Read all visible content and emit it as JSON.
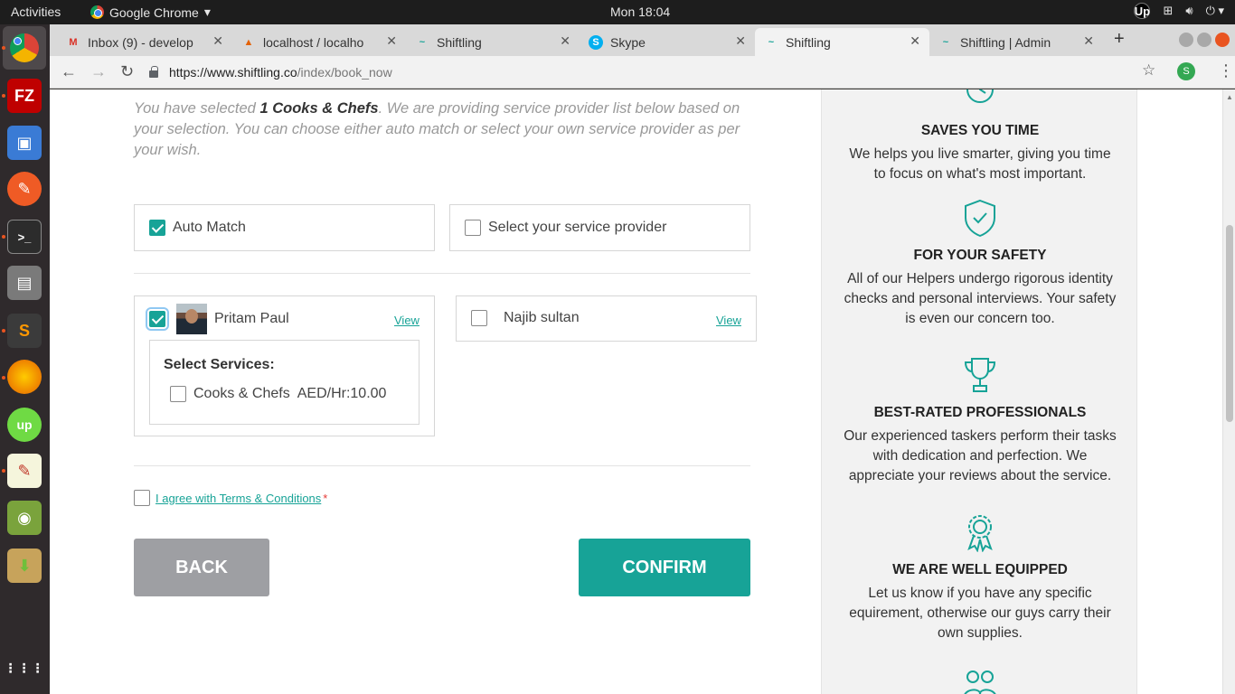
{
  "desktop": {
    "activities": "Activities",
    "app_name": "Google Chrome",
    "clock": "Mon 18:04",
    "tray_badge": "Up"
  },
  "dock": {
    "items": [
      {
        "name": "chrome",
        "color": "#4285f4"
      },
      {
        "name": "filezilla",
        "label": "FZ",
        "color": "#bf0000"
      },
      {
        "name": "image-viewer",
        "color": "#3a7bd5"
      },
      {
        "name": "postman",
        "color": "#ef5b25"
      },
      {
        "name": "terminal",
        "label": ">_",
        "color": "#2c2c2c"
      },
      {
        "name": "files",
        "color": "#7a7a7a"
      },
      {
        "name": "sublime",
        "label": "S",
        "color": "#3b3b3b"
      },
      {
        "name": "firefox",
        "color": "#e66000"
      },
      {
        "name": "upwork",
        "label": "up",
        "color": "#6fda44"
      },
      {
        "name": "text-editor",
        "color": "#f5f5dc"
      },
      {
        "name": "screenshot",
        "color": "#7aa33c"
      },
      {
        "name": "archive-manager",
        "color": "#c7a35b"
      },
      {
        "name": "show-apps",
        "label": "⋮⋮⋮"
      }
    ]
  },
  "browser": {
    "tabs": [
      {
        "label": "Inbox (9) - develop",
        "icon": "M",
        "icon_color": "#d93025",
        "close": "✕"
      },
      {
        "label": "localhost / localho",
        "icon": "▲",
        "icon_color": "#e36209",
        "close": "✕"
      },
      {
        "label": "Shiftling",
        "icon": "~",
        "icon_color": "#17a397",
        "close": "✕"
      },
      {
        "label": "Skype",
        "icon": "S",
        "icon_color": "#00aff0",
        "close": "✕"
      },
      {
        "label": "Shiftling",
        "icon": "~",
        "icon_color": "#17a397",
        "close": "✕"
      },
      {
        "label": "Shiftling | Admin",
        "icon": "~",
        "icon_color": "#17a397",
        "close": "✕"
      }
    ],
    "new_tab": "+",
    "url_host": "https://www.shiftling.co",
    "url_path": "/index/book_now",
    "profile_initial": "S"
  },
  "booking": {
    "intro_prefix": "You have selected",
    "intro_selection": "1 Cooks & Chefs",
    "intro_suffix": ". We are providing service provider list below based on your selection. You can choose either auto match or select your own service provider as per your wish.",
    "auto_match_label": "Auto Match",
    "auto_match_checked": true,
    "select_provider_label": "Select your service provider",
    "select_provider_checked": false,
    "providers": [
      {
        "name": "Pritam Paul",
        "view": "View",
        "checked": true
      },
      {
        "name": "Najib sultan",
        "view": "View",
        "checked": false
      }
    ],
    "services_title": "Select Services:",
    "service_item": "Cooks & Chefs  AED/Hr:10.00",
    "terms_label": "I agree with Terms & Conditions",
    "terms_required": "*",
    "back_label": "BACK",
    "confirm_label": "CONFIRM"
  },
  "sidebar": {
    "features": [
      {
        "title": "SAVES YOU TIME",
        "desc": "We helps you live smarter, giving you time to focus on what's most important.",
        "icon": "clock-icon"
      },
      {
        "title": "FOR YOUR SAFETY",
        "desc": "All of our Helpers undergo rigorous identity checks and personal interviews. Your safety is even our concern too.",
        "icon": "shield-check-icon"
      },
      {
        "title": "BEST-RATED PROFESSIONALS",
        "desc": "Our experienced taskers perform their tasks with dedication and perfection. We appreciate your reviews about the service.",
        "icon": "trophy-icon"
      },
      {
        "title": "WE ARE WELL EQUIPPED",
        "desc": "Let us know if you have any specific equirement, otherwise our guys carry their own supplies.",
        "icon": "award-badge-icon"
      }
    ]
  },
  "colors": {
    "accent": "#17a397",
    "back_button": "#9e9fa3",
    "required": "#e53935"
  }
}
